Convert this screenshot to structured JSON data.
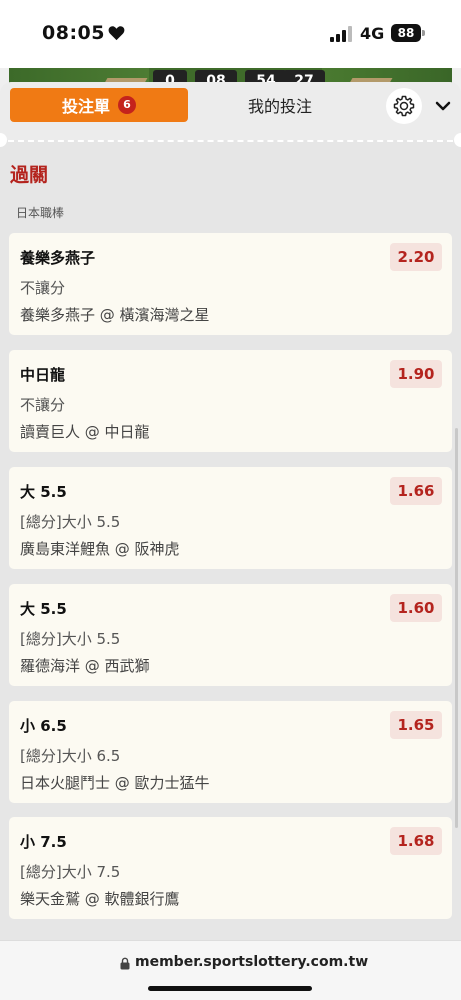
{
  "status_bar": {
    "time": "08:05",
    "network": "4G",
    "battery": "88"
  },
  "scoreboard": [
    "0",
    "08",
    "54",
    "27"
  ],
  "tabs": {
    "bet_slip_label": "投注單",
    "bet_slip_count": "6",
    "my_bets_label": "我的投注"
  },
  "section": {
    "title": "過關",
    "league": "日本職棒"
  },
  "bets": [
    {
      "selection": "養樂多燕子",
      "odds": "2.20",
      "market": "不讓分",
      "match": "養樂多燕子 @ 橫濱海灣之星"
    },
    {
      "selection": "中日龍",
      "odds": "1.90",
      "market": "不讓分",
      "match": "讀賣巨人 @ 中日龍"
    },
    {
      "selection": "大 5.5",
      "odds": "1.66",
      "market": "[總分]大小 5.5",
      "match": "廣島東洋鯉魚 @ 阪神虎"
    },
    {
      "selection": "大 5.5",
      "odds": "1.60",
      "market": "[總分]大小 5.5",
      "match": "羅德海洋 @ 西武獅"
    },
    {
      "selection": "小 6.5",
      "odds": "1.65",
      "market": "[總分]大小 6.5",
      "match": "日本火腿鬥士 @ 歐力士猛牛"
    },
    {
      "selection": "小 7.5",
      "odds": "1.68",
      "market": "[總分]大小 7.5",
      "match": "樂天金鷲 @ 軟體銀行鷹"
    }
  ],
  "browser": {
    "url": "member.sportslottery.com.tw"
  },
  "colors": {
    "accent_orange": "#f07a14",
    "accent_red": "#b4241e"
  }
}
